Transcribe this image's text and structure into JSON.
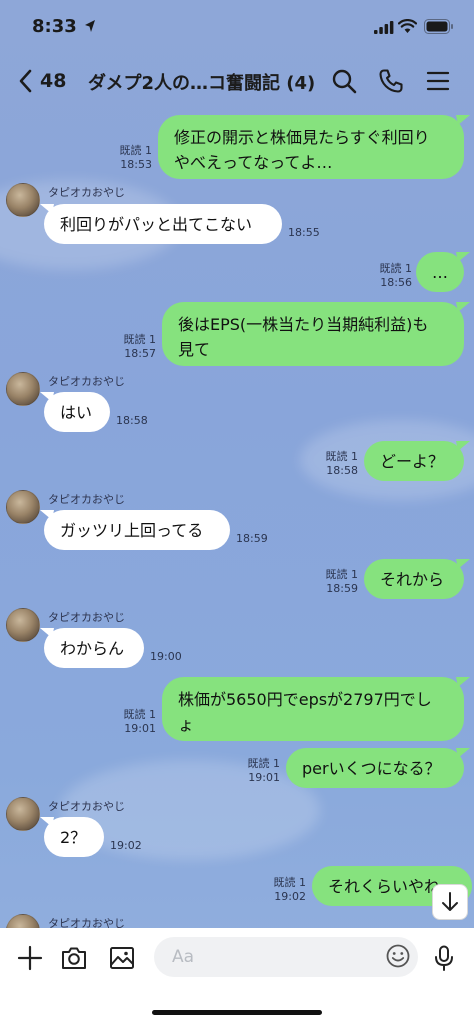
{
  "status_bar": {
    "time": "8:33"
  },
  "header": {
    "back_count": "48",
    "title": "ダメプ2人の…コ奮闘記 (4)"
  },
  "sender_name": "タピオカおやじ",
  "read_label": "既読 1",
  "messages": [
    {
      "dir": "out",
      "text": "修正の開示と株価見たらすぐ利回り\nやべえってなってよ…",
      "time": "18:53",
      "read": "既読 1"
    },
    {
      "dir": "in",
      "text": "利回りがパッと出てこない",
      "time": "18:55"
    },
    {
      "dir": "out",
      "text": "…",
      "time": "18:56",
      "read": "既読 1"
    },
    {
      "dir": "out",
      "text": "後はEPS(一株当たり当期純利益)も\n見て",
      "time": "18:57",
      "read": "既読 1"
    },
    {
      "dir": "in",
      "text": "はい",
      "time": "18:58"
    },
    {
      "dir": "out",
      "text": "どーよ？",
      "time": "18:58",
      "read": "既読 1"
    },
    {
      "dir": "in",
      "text": "ガッツリ上回ってる",
      "time": "18:59"
    },
    {
      "dir": "out",
      "text": "それから",
      "time": "18:59",
      "read": "既読 1"
    },
    {
      "dir": "in",
      "text": "わからん",
      "time": "19:00"
    },
    {
      "dir": "out",
      "text": "株価が5650円でepsが2797円でし\nょ",
      "time": "19:01",
      "read": "既読 1"
    },
    {
      "dir": "out",
      "text": "perいくつになる？",
      "time": "19:01",
      "read": "既読 1"
    },
    {
      "dir": "in",
      "text": "2？",
      "time": "19:02"
    },
    {
      "dir": "out",
      "text": "それくらいやね",
      "time": "19:02",
      "read": "既読 1"
    }
  ],
  "input": {
    "placeholder": "Aa"
  },
  "colors": {
    "bg": "#8aa7da",
    "out_bubble": "#86e27e",
    "in_bubble": "#ffffff"
  },
  "icons": [
    "back-icon",
    "search-icon",
    "phone-icon",
    "menu-icon",
    "plus-icon",
    "camera-icon",
    "image-icon",
    "emoji-icon",
    "mic-icon",
    "scroll-down-icon",
    "location-arrow-icon",
    "signal-icon",
    "wifi-icon",
    "battery-icon"
  ]
}
